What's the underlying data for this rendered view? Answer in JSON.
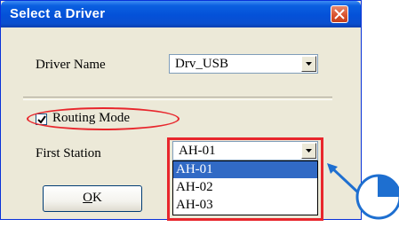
{
  "window": {
    "title": "Select a Driver"
  },
  "driver_name": {
    "label": "Driver Name",
    "value": "Drv_USB"
  },
  "routing_mode": {
    "label": "Routing Mode",
    "checked": true
  },
  "first_station": {
    "label": "First Station",
    "value": "AH-01",
    "options": [
      "AH-01",
      "AH-02",
      "AH-03"
    ],
    "selected_index": 0
  },
  "buttons": {
    "ok_label": "OK"
  },
  "colors": {
    "annotation_red": "#e8262c",
    "annotation_blue": "#1e6fd0",
    "selection_blue": "#316ac5"
  },
  "icons": {
    "close": "close-icon",
    "dropdown_arrow": "chevron-down-icon",
    "check": "check-icon",
    "pointer": "mouse-cursor-icon"
  }
}
